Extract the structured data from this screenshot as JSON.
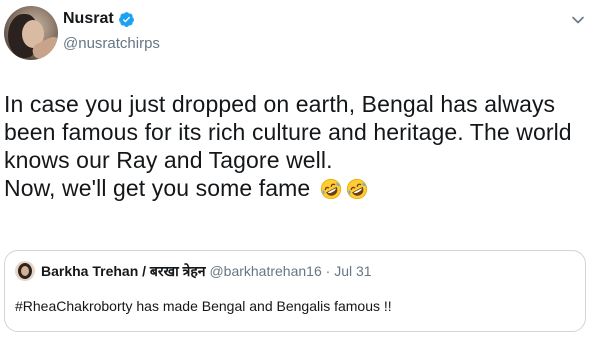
{
  "author": {
    "name": "Nusrat",
    "handle": "@nusratchirps",
    "verified": true
  },
  "icons": {
    "verified": "verified-badge-icon",
    "caret": "chevron-down-icon",
    "emoji": "rolling-on-floor-laughing-emoji"
  },
  "tweet": {
    "lines": [
      "In case you just dropped on earth, Bengal has always",
      "been famous for its rich culture and heritage. The world",
      "knows our Ray and Tagore well.",
      "Now, we'll get you some fame"
    ],
    "emoji_count": 2
  },
  "quoted_tweet": {
    "author_name": "Barkha Trehan / बरखा त्रेहन",
    "handle": "@barkhatrehan16",
    "separator": "·",
    "date": "Jul 31",
    "text": "#RheaChakroborty has made Bengal and Bengalis famous !!"
  },
  "colors": {
    "verified_blue": "#1da1f2",
    "secondary_text": "#657786",
    "border": "#ccd6dd"
  }
}
